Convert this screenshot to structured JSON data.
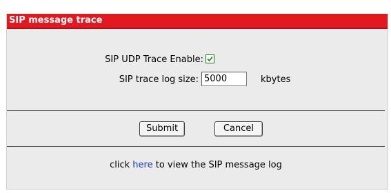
{
  "panel": {
    "title": "SIP message trace"
  },
  "form": {
    "udp_trace_label": "SIP UDP Trace Enable:",
    "udp_trace_checked": true,
    "log_size_label": "SIP trace log size:",
    "log_size_value": "5000",
    "log_size_unit": "kbytes"
  },
  "buttons": {
    "submit": "Submit",
    "cancel": "Cancel"
  },
  "footer": {
    "prefix": "click ",
    "link": "here",
    "suffix": " to view the SIP message log"
  },
  "colors": {
    "title_bar": "#e11a22",
    "panel_bg": "#ebebeb",
    "link": "#1f3fb0"
  }
}
